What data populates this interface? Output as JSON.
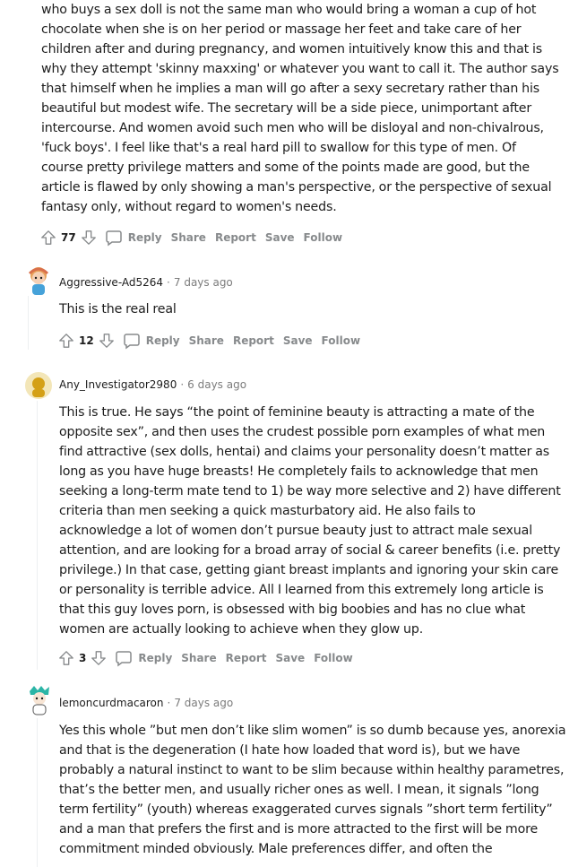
{
  "top_comment": {
    "text": "who buys a sex doll is not the same man who would bring a woman a cup of hot chocolate when she is on her period or massage her feet and take care of her children after and during pregnancy, and women intuitively know this and that is why they attempt 'skinny maxxing' or whatever you want to call it. The author says that himself when he implies a man will go after a sexy secretary rather than his beautiful but modest wife. The secretary will be a side piece, unimportant after intercourse. And women avoid such men who will be disloyal and non-chivalrous, 'fuck boys'. I feel like that's a real hard pill to swallow for this type of men. Of course pretty privilege matters and some of the points made are good, but the article is flawed by only showing a man's perspective, or the perspective of sexual fantasy only, without regard to women's needs.",
    "score": "77"
  },
  "actions": {
    "reply": "Reply",
    "share": "Share",
    "report": "Report",
    "save": "Save",
    "follow": "Follow"
  },
  "comments": [
    {
      "author": "Aggressive-Ad5264",
      "time": "7 days ago",
      "text": "This is the real real",
      "score": "12"
    },
    {
      "author": "Any_Investigator2980",
      "time": "6 days ago",
      "text": "This is true. He says “the point of feminine beauty is attracting a mate of the opposite sex”, and then uses the crudest possible porn examples of what men find attractive (sex dolls, hentai) and claims your personality doesn’t matter as long as you have huge breasts! He completely fails to acknowledge that men seeking a long-term mate tend to 1) be way more selective and 2) have different criteria than men seeking a quick masturbatory aid. He also fails to acknowledge a lot of women don’t pursue beauty just to attract male sexual attention, and are looking for a broad array of social & career benefits (i.e. pretty privilege.) In that case, getting giant breast implants and ignoring your skin care or personality is terrible advice. All I learned from this extremely long article is that this guy loves porn, is obsessed with big boobies and has no clue what women are actually looking to achieve when they glow up.",
      "score": "3"
    },
    {
      "author": "lemoncurdmacaron",
      "time": "7 days ago",
      "text": "Yes this whole ”but men don’t like slim women” is so dumb because yes, anorexia and that is the degeneration (I hate how loaded that word is), but we have probably a natural instinct to want to be slim because within healthy parametres, that’s the better men, and usually richer ones as well. I mean, it signals ”long term fertility” (youth) whereas exaggerated curves signals ”short term fertility” and a man that prefers the first and is more attracted to the first will be more commitment minded obviously. Male preferences differ, and often the"
    }
  ],
  "colors": {
    "meta_gray": "#7c7c7c",
    "action_gray": "#878a8c",
    "thread_line": "#edeff1"
  }
}
